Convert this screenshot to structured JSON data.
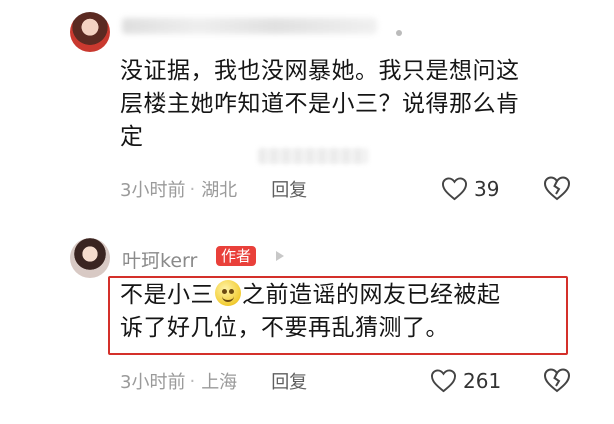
{
  "comments": [
    {
      "lines": [
        "没证据，我也没网暴她。我只是想问这",
        "层楼主她咋知道不是小三？说得那么肯",
        "定"
      ],
      "time": "3小时前",
      "location": "湖北",
      "reply_label": "回复",
      "likes": "39"
    },
    {
      "author": "叶珂kerr",
      "author_badge": "作者",
      "line1_before": "不是小三",
      "line1_after": "之前造谣的网友已经被起",
      "line2": "诉了好几位，不要再乱猜测了。",
      "time": "3小时前",
      "location": "上海",
      "reply_label": "回复",
      "likes": "261"
    }
  ],
  "separator": "·",
  "colors": {
    "highlight": "#d4302a",
    "badge": "#e9403a",
    "meta": "#9a9a9a"
  },
  "icons": [
    "heart-outline-icon",
    "broken-heart-icon",
    "smile-emoji-icon"
  ]
}
